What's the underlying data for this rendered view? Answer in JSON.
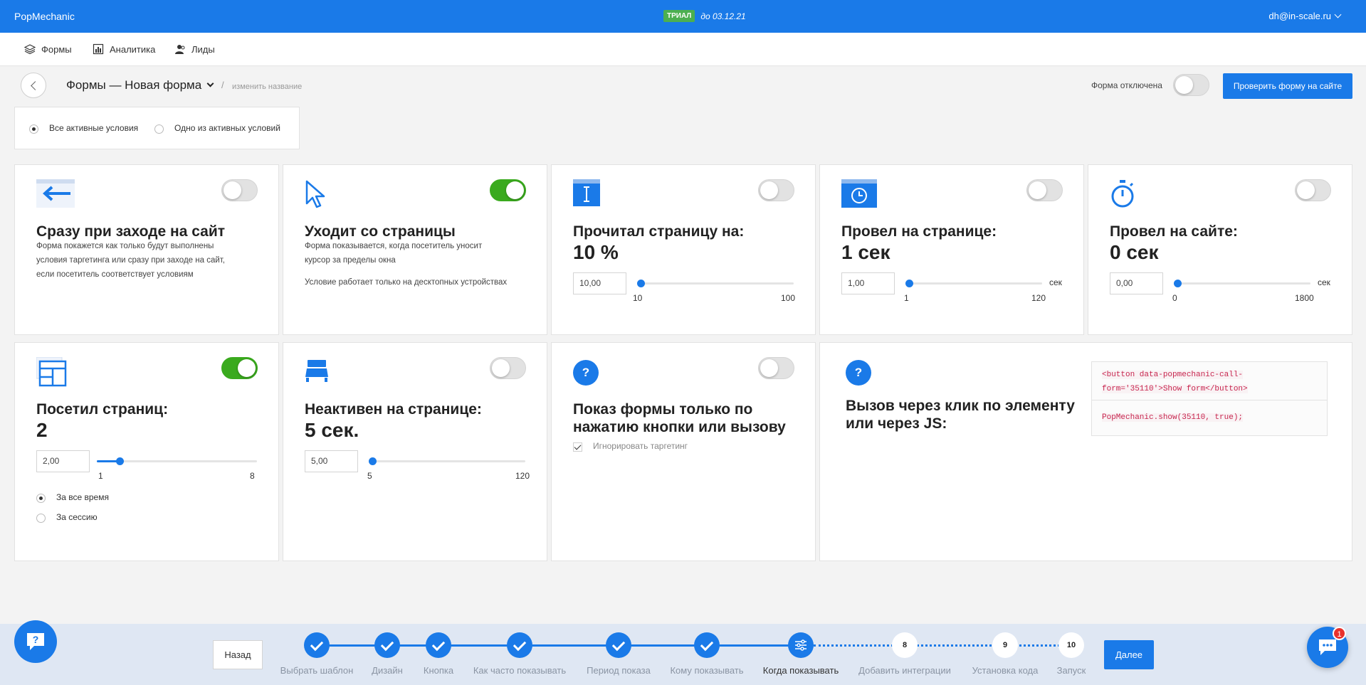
{
  "topbar": {
    "brand": "PopMechanic",
    "trial_badge": "ТРИАЛ",
    "trial_until": "до 03.12.21",
    "user": "dh@in-scale.ru"
  },
  "nav": [
    {
      "label": "Формы",
      "icon": "layers-icon"
    },
    {
      "label": "Аналитика",
      "icon": "bar-chart-icon"
    },
    {
      "label": "Лиды",
      "icon": "users-icon"
    }
  ],
  "header": {
    "title": "Формы — Новая форма",
    "separator": "/",
    "rename": "изменить название",
    "status_label": "Форма отключена",
    "form_enabled": false,
    "check_button": "Проверить форму на сайте"
  },
  "mode": {
    "options": [
      "Все активные условия",
      "Одно из активных условий"
    ],
    "selected": "Все активные условия"
  },
  "cards": {
    "on_enter": {
      "enabled": false,
      "title": "Сразу при заходе на сайт",
      "desc": [
        "Форма покажется как только будут выполнены",
        "условия таргетинга или сразу при заходе на сайт,",
        "если посетитель соответствует условиям"
      ]
    },
    "on_exit": {
      "enabled": true,
      "title": "Уходит со страницы",
      "desc": [
        "Форма показывается, когда посетитель уносит",
        "курсор за пределы окна"
      ],
      "note": "Условие работает только на десктопных устройствах"
    },
    "read_page": {
      "enabled": false,
      "title": "Прочитал страницу на:",
      "value": "10 %",
      "input": "10,00",
      "min": "10",
      "max": "100",
      "slider_fraction": 0
    },
    "time_on_page": {
      "enabled": false,
      "title": "Провел на странице:",
      "value": "1 сек",
      "input": "1,00",
      "unit": "сек",
      "min": "1",
      "max": "120",
      "slider_fraction": 0
    },
    "time_on_site": {
      "enabled": false,
      "title": "Провел на сайте:",
      "value": "0 сек",
      "input": "0,00",
      "unit": "сек",
      "min": "0",
      "max": "1800",
      "slider_fraction": 0
    },
    "pages_visited": {
      "enabled": true,
      "title": "Посетил страниц:",
      "value": "2",
      "input": "2,00",
      "min": "1",
      "max": "8",
      "slider_fraction": 0.143,
      "period_options": [
        "За все время",
        "За сессию"
      ],
      "period_selected": "За все время"
    },
    "inactive": {
      "enabled": false,
      "title": "Неактивен на странице:",
      "value": "5 сек.",
      "input": "5,00",
      "min": "5",
      "max": "120",
      "slider_fraction": 0
    },
    "button_only": {
      "enabled": false,
      "title_lines": [
        "Показ формы только по",
        "нажатию кнопки или вызову"
      ],
      "ignore_label": "Игнорировать таргетинг",
      "ignore_checked": true
    },
    "js_call": {
      "title_lines": [
        "Вызов через клик по элементу",
        "или через JS:"
      ],
      "code_html": [
        "<button data-popmechanic-call-",
        "form='35110'>Show form</button>"
      ],
      "code_js": "PopMechanic.show(35110, true);"
    }
  },
  "wizard": {
    "back": "Назад",
    "next": "Далее",
    "steps": [
      {
        "label": "Выбрать шаблон",
        "state": "done"
      },
      {
        "label": "Дизайн",
        "state": "done"
      },
      {
        "label": "Кнопка",
        "state": "done"
      },
      {
        "label": "Как часто показывать",
        "state": "done"
      },
      {
        "label": "Период показа",
        "state": "done"
      },
      {
        "label": "Кому показывать",
        "state": "done"
      },
      {
        "label": "Когда показывать",
        "state": "current"
      },
      {
        "label": "Добавить интеграции",
        "state": "todo",
        "number": "8"
      },
      {
        "label": "Установка кода",
        "state": "todo",
        "number": "9"
      },
      {
        "label": "Запуск",
        "state": "todo",
        "number": "10"
      }
    ]
  },
  "chat": {
    "badge": "1"
  }
}
